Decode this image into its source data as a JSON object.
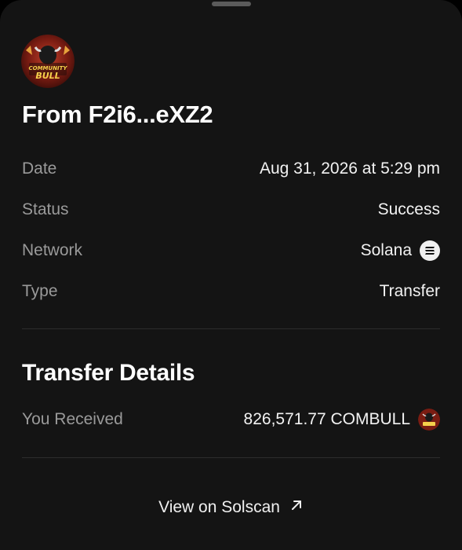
{
  "header": {
    "title": "From F2i6...eXZ2",
    "token_logo": {
      "top_text": "COMMUNITY",
      "bottom_text": "BULL"
    }
  },
  "details": [
    {
      "label": "Date",
      "value": "Aug 31, 2026 at 5:29 pm"
    },
    {
      "label": "Status",
      "value": "Success"
    },
    {
      "label": "Network",
      "value": "Solana",
      "icon": "solana-icon"
    },
    {
      "label": "Type",
      "value": "Transfer"
    }
  ],
  "transfer": {
    "section_title": "Transfer Details",
    "label": "You Received",
    "amount": "826,571.77 COMBULL",
    "token_icon": "community-bull-token-icon"
  },
  "footer": {
    "link_label": "View on Solscan",
    "link_icon": "external-arrow-icon"
  },
  "colors": {
    "background": "#141414",
    "text_primary": "#f2f2f2",
    "text_secondary": "#9a9a9a",
    "divider": "#2c2c2c"
  }
}
